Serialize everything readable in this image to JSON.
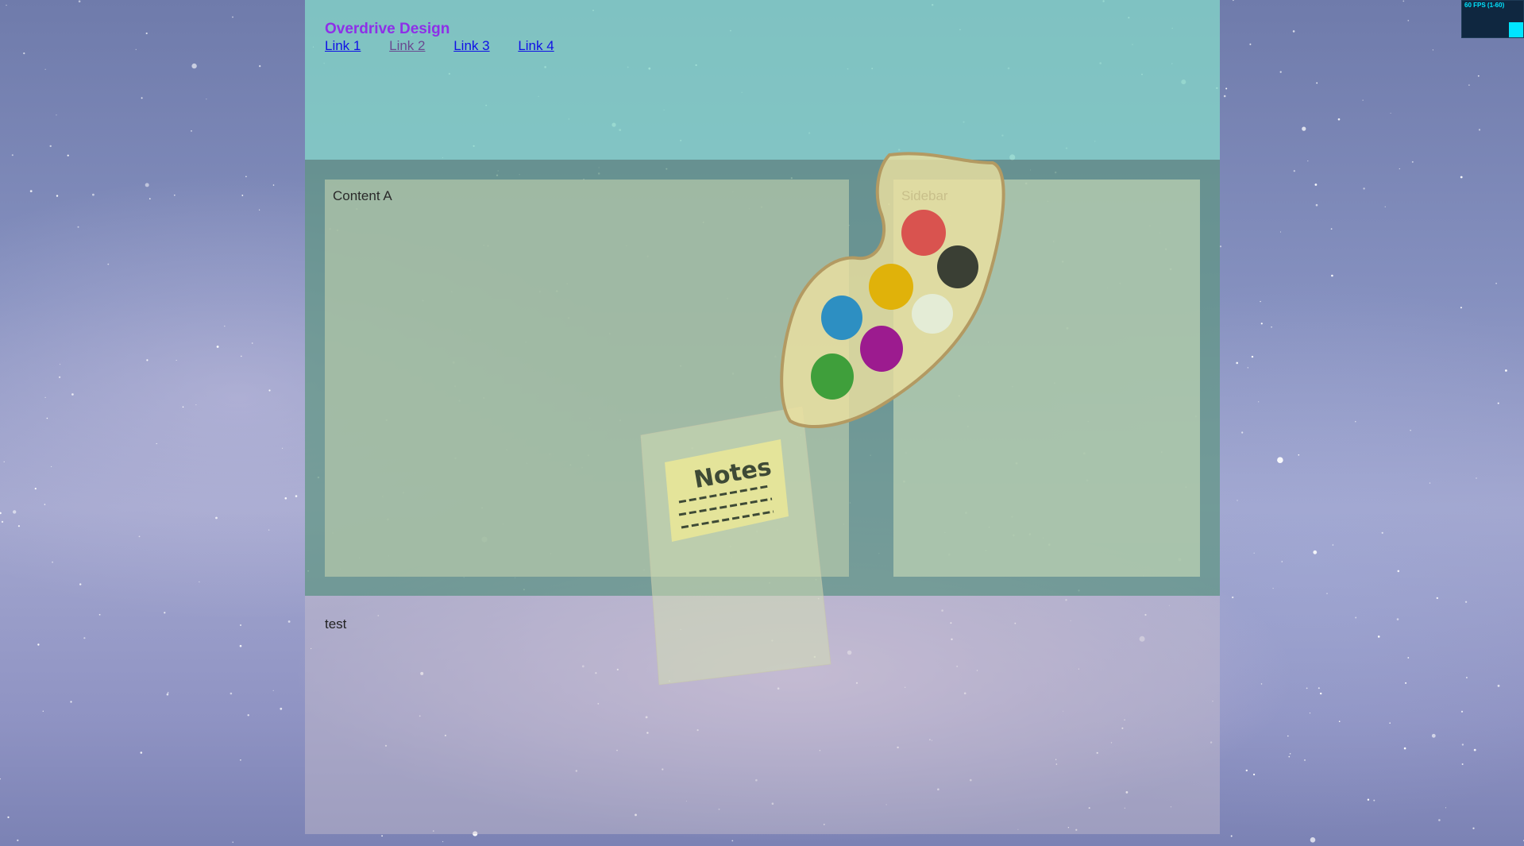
{
  "header": {
    "site_title": "Overdrive Design",
    "nav_links": [
      "Link 1",
      "Link 2",
      "Link 3",
      "Link 4"
    ]
  },
  "main": {
    "content_a_label": "Content A",
    "sidebar_label": "Sidebar"
  },
  "footer": {
    "text": "test"
  },
  "fps_meter": {
    "label": "60 FPS (1-60)"
  },
  "decorations": {
    "palette_icon": "paint-palette-icon",
    "notes_icon": "notes-card-icon",
    "notes_label": "Notes",
    "palette_colors": [
      "#d9534f",
      "#3a3f34",
      "#e0b20a",
      "#e4ecd6",
      "#2d8fc2",
      "#9c1b8f",
      "#3f9f3b"
    ]
  },
  "colors": {
    "title": "#8e2fe8",
    "link": "#1010e6",
    "visited_link": "#6a4a90",
    "header_bg": "#84d6c8",
    "fps_accent": "#00e5ff"
  }
}
